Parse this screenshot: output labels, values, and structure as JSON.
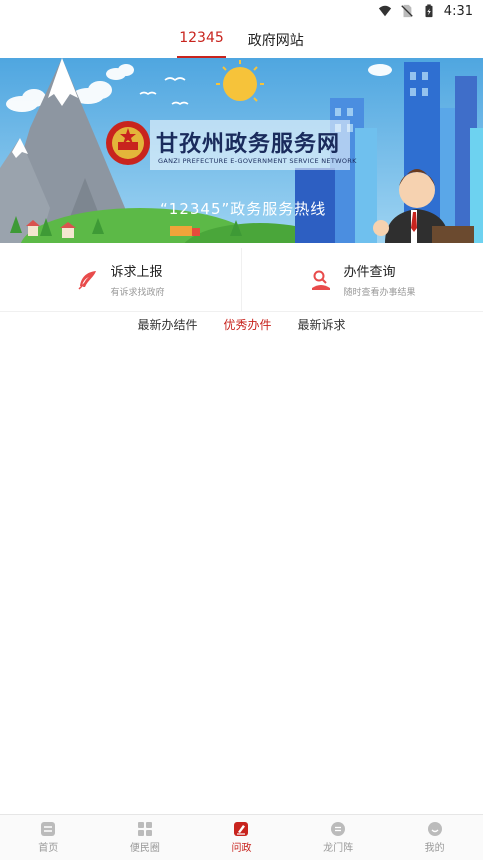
{
  "status_bar": {
    "time": "4:31",
    "icons": [
      "wifi-icon",
      "no-sim-icon",
      "battery-icon"
    ]
  },
  "top_tabs": [
    {
      "label": "12345",
      "active": true
    },
    {
      "label": "政府网站",
      "active": false
    }
  ],
  "banner": {
    "title": "甘孜州政务服务网",
    "subtitle": "GANZI PREFECTURE E-GOVERNMENT SERVICE NETWORK",
    "slogan": "“12345”政务服务热线"
  },
  "services": [
    {
      "title": "诉求上报",
      "subtitle": "有诉求找政府",
      "icon": "feather-icon"
    },
    {
      "title": "办件查询",
      "subtitle": "随时查看办事结果",
      "icon": "person-search-icon"
    }
  ],
  "sub_tabs": [
    {
      "label": "最新办结件",
      "active": false
    },
    {
      "label": "优秀办件",
      "active": true
    },
    {
      "label": "最新诉求",
      "active": false
    }
  ],
  "bottom_nav": [
    {
      "label": "首页",
      "icon": "home-icon",
      "active": false
    },
    {
      "label": "便民圈",
      "icon": "grid-icon",
      "active": false
    },
    {
      "label": "问政",
      "icon": "edit-icon",
      "active": true
    },
    {
      "label": "龙门阵",
      "icon": "chat-icon",
      "active": false
    },
    {
      "label": "我的",
      "icon": "profile-icon",
      "active": false
    }
  ],
  "colors": {
    "accent": "#c8241e",
    "banner_sky": "#5fb3e6"
  }
}
